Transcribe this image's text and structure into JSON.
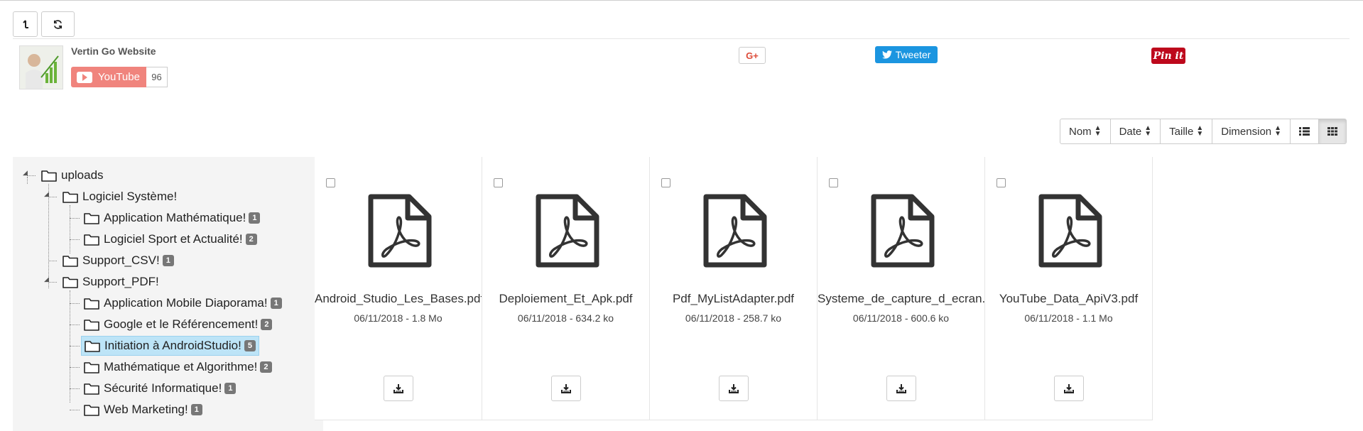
{
  "toolbar": {
    "up_icon": "arrow-up-icon",
    "refresh_icon": "refresh-icon"
  },
  "social": {
    "site_name": "Vertin Go Website",
    "youtube_label": "YouTube",
    "youtube_count": "96",
    "gplus_label": "G+",
    "tweet_label": "Tweeter",
    "pin_label": "Pin it"
  },
  "sort": {
    "name": "Nom",
    "date": "Date",
    "size": "Taille",
    "dimension": "Dimension"
  },
  "tree": {
    "root": "uploads",
    "logiciel": "Logiciel Système!",
    "app_math": "Application Mathématique!",
    "app_math_count": "1",
    "sport": "Logiciel Sport et Actualité!",
    "sport_count": "2",
    "csv": "Support_CSV!",
    "csv_count": "1",
    "pdf": "Support_PDF!",
    "mobile": "Application Mobile Diaporama!",
    "mobile_count": "1",
    "google": "Google et le Référencement!",
    "google_count": "2",
    "android": "Initiation à AndroidStudio!",
    "android_count": "5",
    "math": "Mathématique et Algorithme!",
    "math_count": "2",
    "secu": "Sécurité Informatique!",
    "secu_count": "1",
    "web": "Web Marketing!",
    "web_count": "1"
  },
  "files": [
    {
      "name": "Android_Studio_Les_Bases.pdf",
      "meta": "06/11/2018 - 1.8 Mo"
    },
    {
      "name": "Deploiement_Et_Apk.pdf",
      "meta": "06/11/2018 - 634.2 ko"
    },
    {
      "name": "Pdf_MyListAdapter.pdf",
      "meta": "06/11/2018 - 258.7 ko"
    },
    {
      "name": "Systeme_de_capture_d_ecran.pdf",
      "meta": "06/11/2018 - 600.6 ko"
    },
    {
      "name": "YouTube_Data_ApiV3.pdf",
      "meta": "06/11/2018 - 1.1 Mo"
    }
  ],
  "colors": {
    "youtube": "#f0847d",
    "twitter": "#1b95e0",
    "pinterest": "#bd081c",
    "selected": "#bde4f7"
  }
}
